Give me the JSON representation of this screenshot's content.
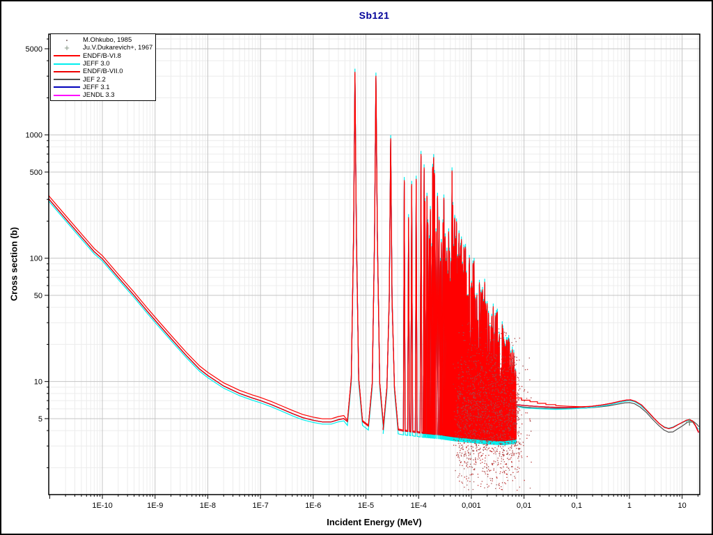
{
  "window": {
    "background": "#ffffff",
    "border_color": "#000000"
  },
  "chart_data": {
    "type": "line",
    "title": "Sb121",
    "title_color": "#000099",
    "xlabel": "Incident Energy (MeV)",
    "ylabel": "Cross section (b)",
    "x_scale": "log",
    "y_scale": "log",
    "xlim": [
      9.6e-12,
      21.6
    ],
    "ylim": [
      1.21,
      6570
    ],
    "grid": {
      "major_color": "#c4c4c4",
      "minor_color": "#ececec",
      "shown": true
    },
    "frame_color": "#000000",
    "x_ticks": [
      {
        "v": 1e-10,
        "label": "1E-10"
      },
      {
        "v": 1e-09,
        "label": "1E-9"
      },
      {
        "v": 1e-08,
        "label": "1E-8"
      },
      {
        "v": 1e-07,
        "label": "1E-7"
      },
      {
        "v": 1e-06,
        "label": "1E-6"
      },
      {
        "v": 1e-05,
        "label": "1E-5"
      },
      {
        "v": 0.0001,
        "label": "1E-4"
      },
      {
        "v": 0.001,
        "label": "0,001"
      },
      {
        "v": 0.01,
        "label": "0,01"
      },
      {
        "v": 0.1,
        "label": "0,1"
      },
      {
        "v": 1,
        "label": "1"
      },
      {
        "v": 10,
        "label": "10"
      }
    ],
    "y_ticks": [
      {
        "v": 5000,
        "label": "5000"
      },
      {
        "v": 1000,
        "label": "1000"
      },
      {
        "v": 500,
        "label": "500"
      },
      {
        "v": 100,
        "label": "100"
      },
      {
        "v": 50,
        "label": "50"
      },
      {
        "v": 10,
        "label": "10"
      },
      {
        "v": 5,
        "label": "5"
      }
    ],
    "legend": [
      {
        "label": "M.Ohkubo, 1985",
        "marker": "dot",
        "color": "#9a8888"
      },
      {
        "label": "Ju.V.Dukarevich+, 1967",
        "marker": "plus",
        "color": "#7d8f7d"
      },
      {
        "label": "ENDF/B-VI.8",
        "marker": "line",
        "color": "#ff0000"
      },
      {
        "label": "JEFF 3.0",
        "marker": "line",
        "color": "#00eeee"
      },
      {
        "label": "ENDF/B-VII.0",
        "marker": "line",
        "color": "#ee0000"
      },
      {
        "label": "JEF 2.2",
        "marker": "line",
        "color": "#505050"
      },
      {
        "label": "JEFF 3.1",
        "marker": "line",
        "color": "#0000bb"
      },
      {
        "label": "JENDL 3.3",
        "marker": "line",
        "color": "#ff00ff"
      }
    ],
    "base_curve": [
      [
        9.6e-12,
        305
      ],
      [
        1e-11,
        297
      ],
      [
        2e-11,
        210
      ],
      [
        4e-11,
        149
      ],
      [
        7e-11,
        113
      ],
      [
        1e-10,
        99
      ],
      [
        2e-10,
        70
      ],
      [
        4e-10,
        50
      ],
      [
        7e-10,
        37.5
      ],
      [
        1e-09,
        31.4
      ],
      [
        2e-09,
        22.4
      ],
      [
        4e-09,
        16.1
      ],
      [
        7e-09,
        12.6
      ],
      [
        1e-08,
        11.2
      ],
      [
        2e-08,
        9.2
      ],
      [
        4e-08,
        8.0
      ],
      [
        7e-08,
        7.35
      ],
      [
        1e-07,
        7.0
      ],
      [
        1.6e-07,
        6.5
      ],
      [
        2.5e-07,
        6.0
      ],
      [
        4e-07,
        5.5
      ],
      [
        6.3e-07,
        5.1
      ],
      [
        1e-06,
        4.85
      ],
      [
        1.5e-06,
        4.7
      ],
      [
        2.2e-06,
        4.7
      ],
      [
        3e-06,
        4.9
      ],
      [
        3.8e-06,
        5.0
      ]
    ],
    "floor_points": [
      [
        3.8e-06,
        5.0
      ],
      [
        8e-06,
        4.6
      ],
      [
        1.2e-05,
        4.55
      ],
      [
        2e-05,
        4.15
      ],
      [
        3.5e-05,
        4.0
      ],
      [
        6e-05,
        3.95
      ],
      [
        0.00012,
        3.8
      ],
      [
        0.00025,
        3.7
      ],
      [
        0.0005,
        3.55
      ],
      [
        0.001,
        3.45
      ],
      [
        0.002,
        3.35
      ],
      [
        0.004,
        3.3
      ],
      [
        0.007,
        3.4
      ]
    ],
    "resonances": [
      [
        6.2e-06,
        3250,
        1
      ],
      [
        1.55e-05,
        3020,
        1
      ],
      [
        2.95e-05,
        940,
        1
      ],
      [
        5.35e-05,
        430,
        0
      ],
      [
        6.45e-05,
        215,
        0
      ],
      [
        7.4e-05,
        400,
        0
      ],
      [
        9e-05,
        440,
        0
      ],
      [
        0.000111,
        700,
        0
      ],
      [
        0.000127,
        545,
        0
      ],
      [
        0.000132,
        290,
        0
      ],
      [
        0.000144,
        320,
        0
      ],
      [
        0.00015,
        195,
        0
      ],
      [
        0.00016,
        145,
        0
      ],
      [
        0.000167,
        250,
        0
      ],
      [
        0.000178,
        125,
        0
      ],
      [
        0.000185,
        550,
        0
      ],
      [
        0.000193,
        660,
        0
      ],
      [
        0.0002,
        490,
        0
      ],
      [
        0.000214,
        165,
        0
      ],
      [
        0.000229,
        320,
        0
      ],
      [
        0.000245,
        205,
        0
      ],
      [
        0.00026,
        95,
        0
      ],
      [
        0.00027,
        135,
        0
      ],
      [
        0.00029,
        195,
        0
      ],
      [
        0.000302,
        310,
        0
      ],
      [
        0.00032,
        150,
        0
      ],
      [
        0.000332,
        95,
        0
      ],
      [
        0.000345,
        115,
        0
      ],
      [
        0.00036,
        75,
        0
      ],
      [
        0.000372,
        165,
        0
      ],
      [
        0.000385,
        115,
        0
      ],
      [
        0.0004,
        65,
        0
      ],
      [
        0.000414,
        95,
        0
      ],
      [
        0.00043,
        515,
        0
      ],
      [
        0.000445,
        270,
        0
      ]
    ],
    "dense_band": {
      "from": 0.00045,
      "to": 0.007,
      "count": 320,
      "env_at_from": 260,
      "env_exp": 1.0,
      "env_min": 14,
      "seed": 12345
    },
    "series": [
      {
        "name": "JENDL 3.3",
        "color": "#ff00ff",
        "base_scale": 1.0,
        "peak_scale": 0.96,
        "floor_scale": 1.0,
        "tail": "red_lo"
      },
      {
        "name": "JEFF 3.1",
        "color": "#0000bb",
        "base_scale": 1.0,
        "peak_scale": 0.96,
        "floor_scale": 1.0,
        "tail": "red_lo"
      },
      {
        "name": "JEF 2.2",
        "color": "#505050",
        "base_scale": 1.0,
        "peak_scale": 0.96,
        "floor_scale": 1.0,
        "tail": "gray"
      },
      {
        "name": "JEFF 3.0",
        "color": "#00eeee",
        "base_scale": 0.96,
        "peak_scale": 1.06,
        "floor_scale": 0.93,
        "tail": "cyan"
      },
      {
        "name": "ENDF/B-VII.0",
        "color": "#ee0000",
        "base_scale": 1.0,
        "peak_scale": 0.97,
        "floor_scale": 1.0,
        "tail": "red_lo"
      },
      {
        "name": "ENDF/B-VI.8",
        "color": "#ff0000",
        "base_scale": 1.06,
        "peak_scale": 1.0,
        "floor_scale": 1.02,
        "tail": "red_step"
      }
    ],
    "tails": {
      "red_step": [
        [
          0.007,
          7.35
        ],
        [
          0.009,
          7.35
        ],
        [
          0.009,
          7.05
        ],
        [
          0.013,
          7.05
        ],
        [
          0.013,
          6.85
        ],
        [
          0.018,
          6.85
        ],
        [
          0.018,
          6.65
        ],
        [
          0.026,
          6.65
        ],
        [
          0.026,
          6.5
        ],
        [
          0.04,
          6.5
        ],
        [
          0.04,
          6.38
        ],
        [
          0.07,
          6.3
        ],
        [
          0.12,
          6.25
        ],
        [
          0.19,
          6.3
        ],
        [
          0.3,
          6.45
        ],
        [
          0.45,
          6.65
        ],
        [
          0.65,
          6.9
        ],
        [
          0.85,
          7.05
        ],
        [
          1.05,
          7.1
        ],
        [
          1.3,
          6.9
        ],
        [
          1.7,
          6.45
        ],
        [
          2.2,
          5.75
        ],
        [
          2.9,
          5.05
        ],
        [
          3.7,
          4.55
        ],
        [
          4.6,
          4.25
        ],
        [
          5.6,
          4.15
        ],
        [
          6.8,
          4.25
        ],
        [
          8.2,
          4.45
        ],
        [
          10,
          4.65
        ],
        [
          12,
          4.85
        ],
        [
          14,
          4.92
        ],
        [
          16,
          4.75
        ],
        [
          18,
          4.4
        ],
        [
          20.5,
          3.9
        ]
      ],
      "red_lo": [
        [
          0.007,
          6.5
        ],
        [
          0.01,
          6.4
        ],
        [
          0.016,
          6.3
        ],
        [
          0.03,
          6.2
        ],
        [
          0.06,
          6.15
        ],
        [
          0.12,
          6.2
        ],
        [
          0.19,
          6.28
        ],
        [
          0.3,
          6.45
        ],
        [
          0.45,
          6.65
        ],
        [
          0.65,
          6.9
        ],
        [
          0.85,
          7.05
        ],
        [
          1.05,
          7.1
        ],
        [
          1.3,
          6.9
        ],
        [
          1.7,
          6.45
        ],
        [
          2.2,
          5.75
        ],
        [
          2.9,
          5.05
        ],
        [
          3.7,
          4.55
        ],
        [
          4.6,
          4.25
        ],
        [
          5.6,
          4.15
        ],
        [
          6.8,
          4.25
        ],
        [
          8.2,
          4.45
        ],
        [
          10,
          4.65
        ],
        [
          12,
          4.85
        ],
        [
          14,
          4.9
        ],
        [
          16,
          4.7
        ],
        [
          18,
          4.35
        ],
        [
          20.5,
          3.85
        ]
      ],
      "cyan": [
        [
          0.0025,
          8.2
        ],
        [
          0.0032,
          7.6
        ],
        [
          0.0032,
          7.3
        ],
        [
          0.0042,
          7.05
        ],
        [
          0.0055,
          6.6
        ],
        [
          0.007,
          6.3
        ],
        [
          0.01,
          6.1
        ],
        [
          0.02,
          6.0
        ],
        [
          0.04,
          5.95
        ],
        [
          0.08,
          6.0
        ],
        [
          0.15,
          6.1
        ],
        [
          0.25,
          6.25
        ],
        [
          0.4,
          6.45
        ],
        [
          0.6,
          6.7
        ],
        [
          0.8,
          6.9
        ],
        [
          1.0,
          7.0
        ],
        [
          1.25,
          6.85
        ],
        [
          1.6,
          6.45
        ],
        [
          2.1,
          5.8
        ],
        [
          2.8,
          5.1
        ],
        [
          3.6,
          4.6
        ],
        [
          4.5,
          4.3
        ],
        [
          5.5,
          4.18
        ],
        [
          6.7,
          4.28
        ],
        [
          8,
          4.45
        ],
        [
          10,
          4.62
        ],
        [
          12,
          4.8
        ],
        [
          14,
          4.85
        ],
        [
          16,
          4.65
        ],
        [
          18,
          4.35
        ],
        [
          20.5,
          4.1
        ]
      ],
      "gray": [
        [
          0.003,
          7.4
        ],
        [
          0.004,
          7.0
        ],
        [
          0.0055,
          6.6
        ],
        [
          0.007,
          6.35
        ],
        [
          0.01,
          6.2
        ],
        [
          0.02,
          6.1
        ],
        [
          0.04,
          6.05
        ],
        [
          0.08,
          6.05
        ],
        [
          0.15,
          6.1
        ],
        [
          0.25,
          6.2
        ],
        [
          0.4,
          6.35
        ],
        [
          0.6,
          6.55
        ],
        [
          0.8,
          6.7
        ],
        [
          1.0,
          6.75
        ],
        [
          1.25,
          6.6
        ],
        [
          1.6,
          6.2
        ],
        [
          2.1,
          5.6
        ],
        [
          2.8,
          4.9
        ],
        [
          3.6,
          4.4
        ],
        [
          4.5,
          4.05
        ],
        [
          5.5,
          3.88
        ],
        [
          6.7,
          3.9
        ],
        [
          8,
          4.1
        ],
        [
          10,
          4.35
        ],
        [
          12,
          4.6
        ],
        [
          14,
          4.78
        ],
        [
          15.5,
          4.82
        ],
        [
          17,
          4.68
        ],
        [
          19,
          4.5
        ],
        [
          20.8,
          4.3
        ]
      ]
    },
    "scatter_cloud": {
      "name": "M.Ohkubo, 1985",
      "from": 0.00043,
      "to": 0.0135,
      "count": 1750,
      "center": 5.3,
      "log_sd": 0.29,
      "min": 1.3,
      "max": 60,
      "seed": 777,
      "colors": [
        "#c22727",
        "#b64040",
        "#a34e4e"
      ]
    },
    "dukarevich_point": {
      "name": "Ju.V.Dukarevich+, 1967",
      "x": 13.8,
      "y": 4.68,
      "color": "#7d8f7d"
    }
  }
}
